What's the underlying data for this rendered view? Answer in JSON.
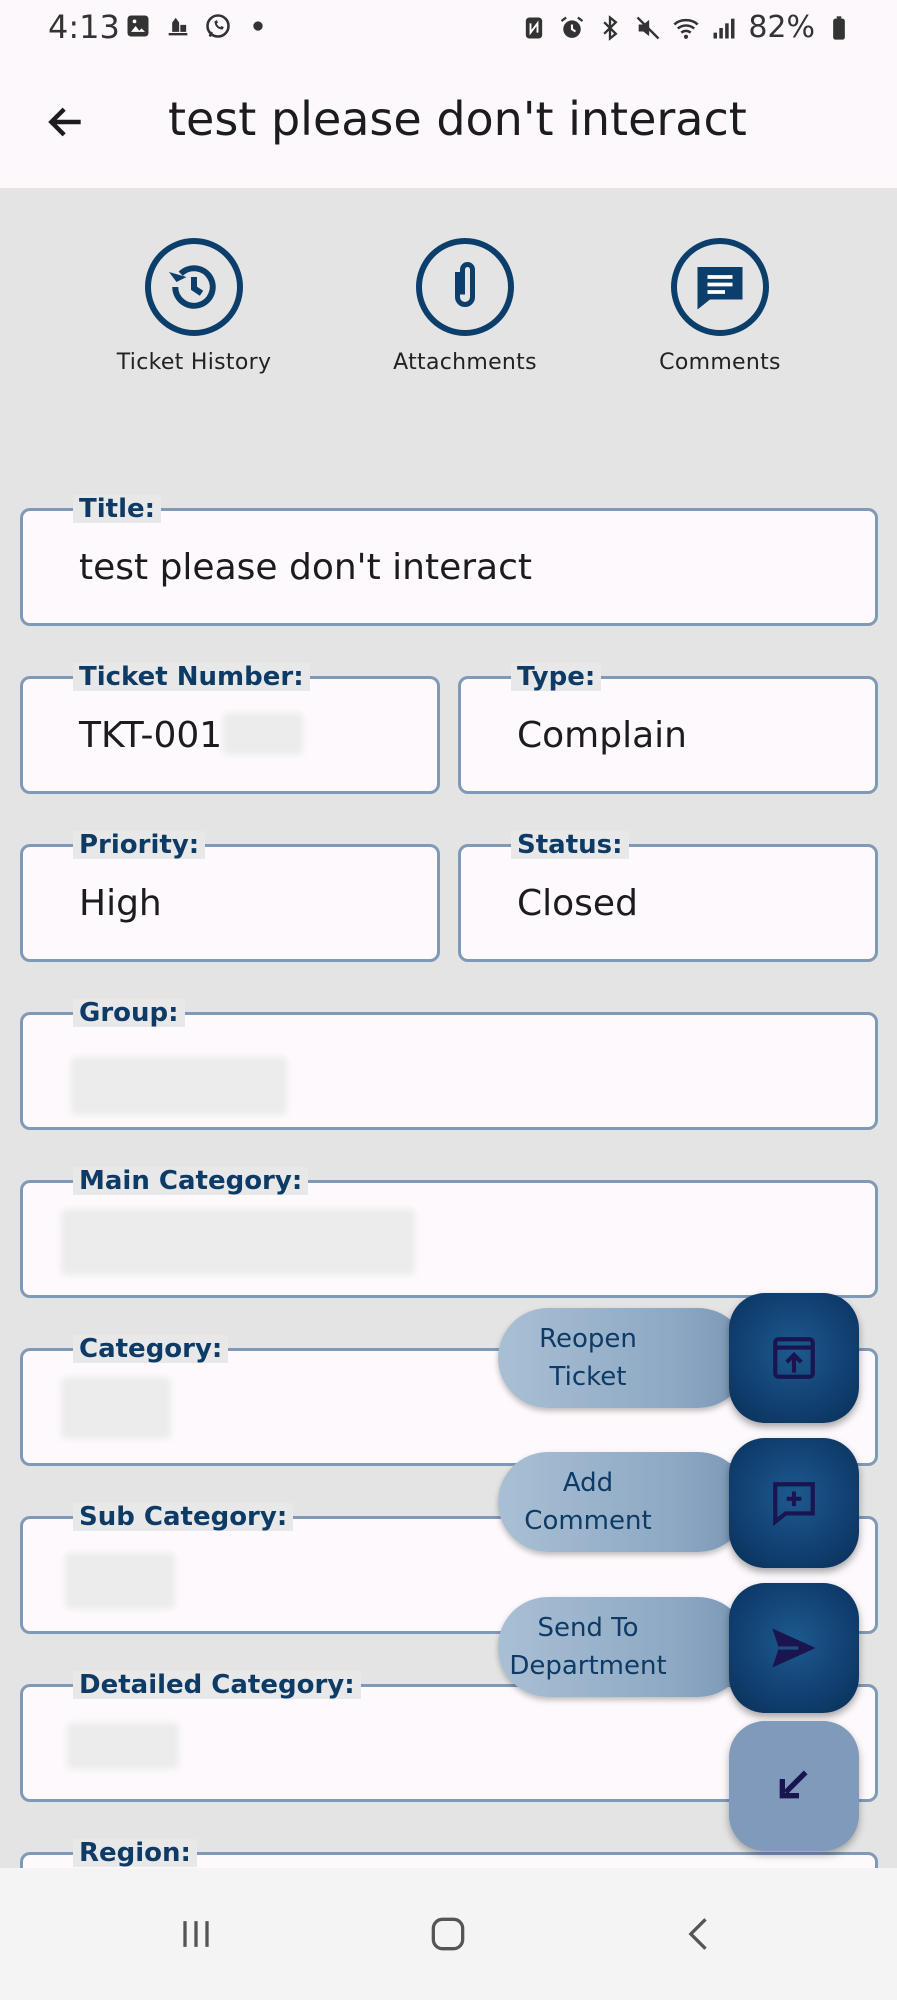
{
  "status_bar": {
    "time": "4:13",
    "battery": "82%",
    "left_icons": [
      "gallery-icon",
      "app-icon",
      "whatsapp-icon",
      "dot-icon"
    ],
    "right_icons": [
      "nfc-icon",
      "alarm-icon",
      "bluetooth-icon",
      "mute-icon",
      "wifi-icon",
      "signal-icon",
      "battery-icon"
    ]
  },
  "app_bar": {
    "title": "test please don't interact",
    "back_icon": "arrow-left-icon"
  },
  "actions": [
    {
      "label": "Ticket History",
      "icon": "history-icon"
    },
    {
      "label": "Attachments",
      "icon": "paperclip-icon"
    },
    {
      "label": "Comments",
      "icon": "comment-icon"
    }
  ],
  "fields": {
    "title": {
      "label": "Title:",
      "value": "test please don't interact"
    },
    "ticket_number": {
      "label": "Ticket Number:",
      "value": "TKT-001"
    },
    "type": {
      "label": "Type:",
      "value": "Complain"
    },
    "priority": {
      "label": "Priority:",
      "value": "High"
    },
    "status": {
      "label": "Status:",
      "value": "Closed"
    },
    "group": {
      "label": "Group:",
      "value": ""
    },
    "main_category": {
      "label": "Main Category:",
      "value": ""
    },
    "category": {
      "label": "Category:",
      "value": ""
    },
    "sub_category": {
      "label": "Sub Category:",
      "value": ""
    },
    "detailed_category": {
      "label": "Detailed Category:",
      "value": ""
    },
    "region": {
      "label": "Region:",
      "value": ""
    }
  },
  "fab_menu": {
    "reopen": {
      "label": "Reopen Ticket",
      "icon": "reopen-icon"
    },
    "add_comment": {
      "label": "Add Comment",
      "icon": "add-comment-icon"
    },
    "send_department": {
      "label": "Send To Department",
      "icon": "send-icon"
    },
    "collapse_icon": "arrow-down-left-icon"
  },
  "colors": {
    "primary": "#0d3b66",
    "field_border": "#7f9ab8",
    "background": "#e4e4e4",
    "surface": "#fdf8fc"
  }
}
